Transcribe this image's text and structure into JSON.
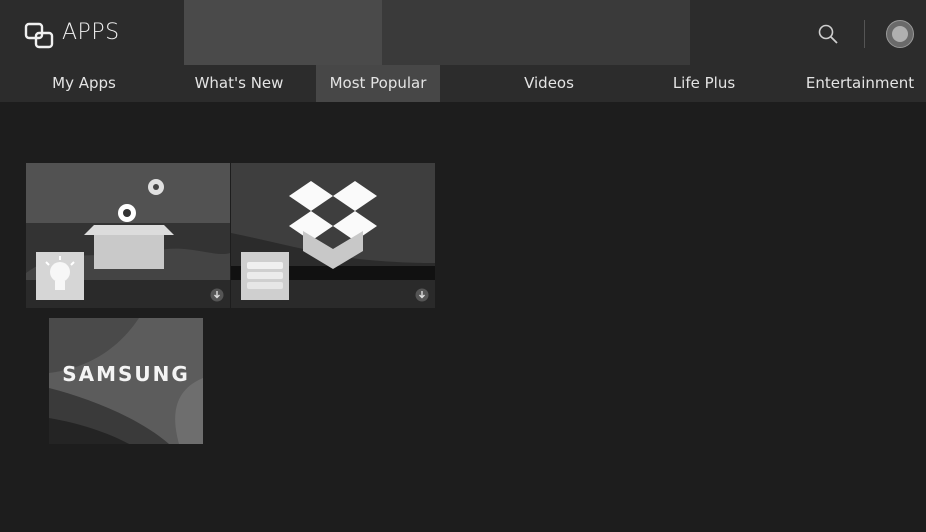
{
  "header": {
    "title": "APPS",
    "icons": {
      "apps": "apps-icon",
      "search": "search-icon",
      "profile": "avatar"
    }
  },
  "tabs": [
    {
      "label": "My Apps"
    },
    {
      "label": "What's New"
    },
    {
      "label": "Most Popular"
    },
    {
      "label": "Videos"
    },
    {
      "label": "Life Plus"
    },
    {
      "label": "Entertainment"
    }
  ],
  "active_tab": "Most Popular",
  "tiles": [
    {
      "icon": "lightbulb-icon",
      "status_icon": "download-icon"
    },
    {
      "icon": "stack-icon",
      "status_icon": "download-icon"
    },
    {
      "logo": "SAMSUNG"
    }
  ],
  "colors": {
    "background": "#1d1d1d",
    "header": "#2c2c2c",
    "active_tab": "#474747"
  }
}
